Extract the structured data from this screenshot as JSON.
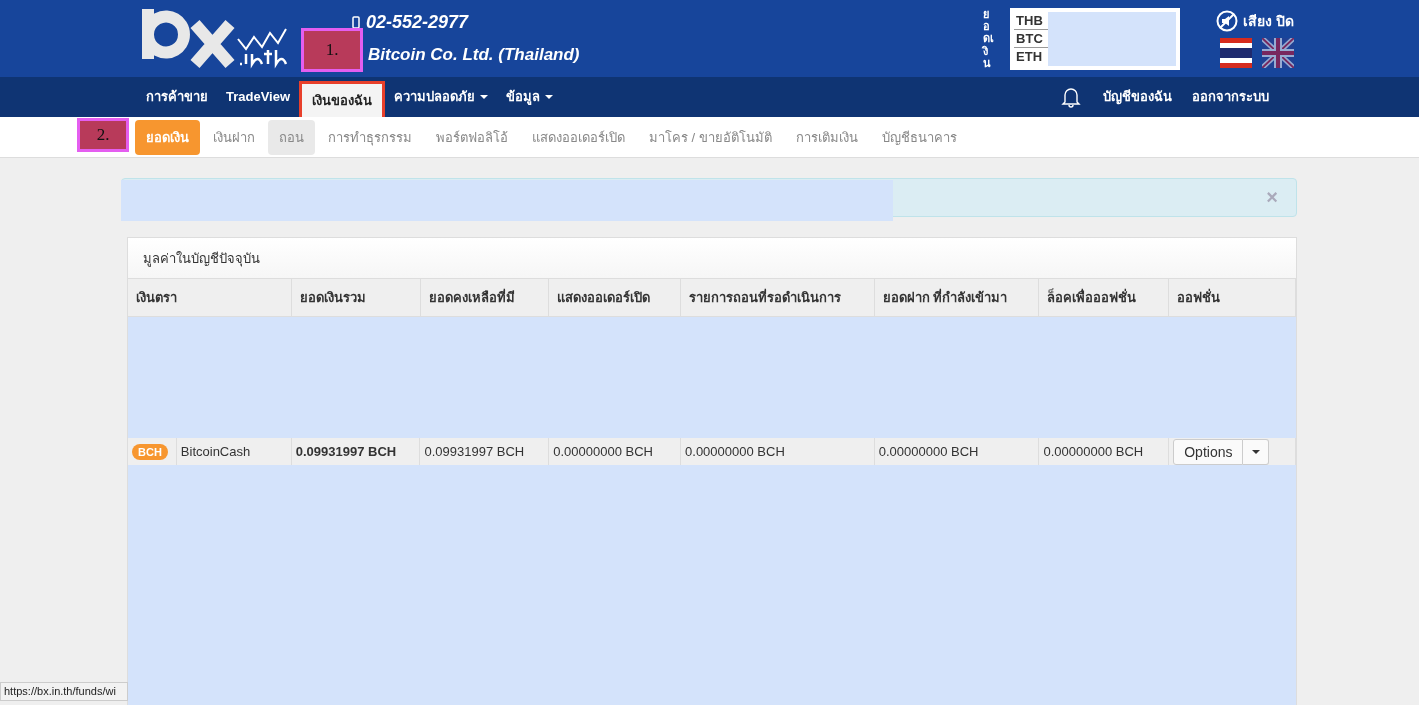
{
  "header": {
    "phone": "02-552-2977",
    "company": "Bitcoin Co. Ltd. (Thailand)",
    "balance_label": "ยอดเงิน",
    "balances": [
      {
        "currency": "THB"
      },
      {
        "currency": "BTC"
      },
      {
        "currency": "ETH"
      }
    ],
    "sound": "เสียง ปิด",
    "languages": [
      {
        "kind": "thai",
        "selected": true
      },
      {
        "kind": "uk",
        "selected": false
      }
    ]
  },
  "nav": {
    "items": [
      {
        "label": "การค้าขาย",
        "selected": false,
        "dropdown": false
      },
      {
        "label": "TradeView",
        "selected": false,
        "dropdown": false
      },
      {
        "label": "เงินของฉัน",
        "selected": true,
        "dropdown": false
      },
      {
        "label": "ความปลอดภัย",
        "selected": false,
        "dropdown": true
      },
      {
        "label": "ข้อมูล",
        "selected": false,
        "dropdown": true
      }
    ],
    "right": [
      "บัญชีของฉัน",
      "ออกจากระบบ"
    ]
  },
  "subnav": [
    {
      "label": "ยอดเงิน",
      "selected": true,
      "highlighted": false
    },
    {
      "label": "เงินฝาก",
      "selected": false,
      "highlighted": false
    },
    {
      "label": "ถอน",
      "selected": false,
      "highlighted": true
    },
    {
      "label": "การทำธุรกรรม",
      "selected": false,
      "highlighted": false
    },
    {
      "label": "พอร์ตฟอลิโอ้",
      "selected": false,
      "highlighted": false
    },
    {
      "label": "แสดงออเดอร์เปิด",
      "selected": false,
      "highlighted": false
    },
    {
      "label": "มาโคร / ขายอัติโนมัติ",
      "selected": false,
      "highlighted": false
    },
    {
      "label": "การเติมเงิน",
      "selected": false,
      "highlighted": false
    },
    {
      "label": "บัญชีธนาคาร",
      "selected": false,
      "highlighted": false
    }
  ],
  "annotations": [
    "1.",
    "2."
  ],
  "alert": {
    "close": "×"
  },
  "panel": {
    "title": "มูลค่าในบัญชีปัจจุบัน",
    "columns": [
      "เงินตรา",
      "ยอดเงินรวม",
      "ยอดคงเหลือที่มี",
      "แสดงออเดอร์เปิด",
      "รายการถอนที่รอดำเนินการ",
      "ยอดฝาก ที่กำลังเข้ามา",
      "ล็อคเพื่อออฟชั่น",
      "ออฟชั่น"
    ],
    "rows": [
      {
        "badge": "BCH",
        "name": "BitcoinCash",
        "total": "0.09931997 BCH",
        "available": "0.09931997 BCH",
        "open_orders": "0.00000000 BCH",
        "pending_withdrawals": "0.00000000 BCH",
        "incoming_deposits": "0.00000000 BCH",
        "locked": "0.00000000 BCH",
        "button": "Options"
      }
    ]
  },
  "status_bar": {
    "url": "https://bx.in.th/funds/wi"
  }
}
